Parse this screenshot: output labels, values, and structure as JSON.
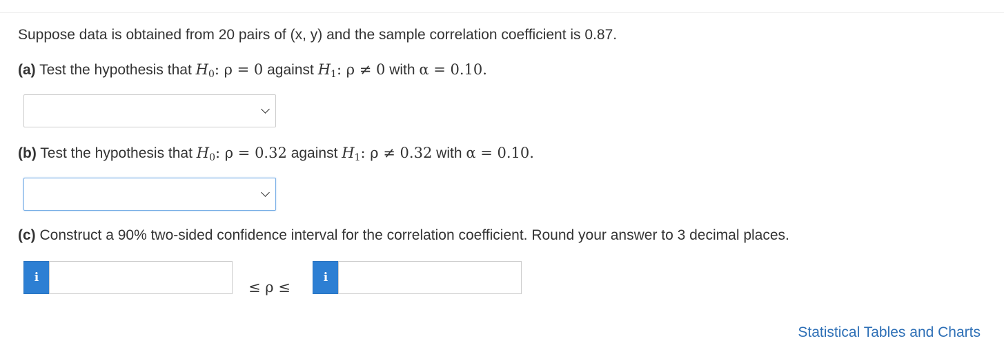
{
  "problem": {
    "intro": "Suppose data is obtained from 20 pairs of (x, y) and the sample correlation coefficient is 0.87.",
    "part_a": {
      "label": "(a)",
      "text_before": "Test the hypothesis that",
      "h0_symbol": "H",
      "h0_sub": "0",
      "h0_expr": ": ρ = 0",
      "against": "against",
      "h1_symbol": "H",
      "h1_sub": "1",
      "h1_expr": ": ρ ≠ 0",
      "with": "with",
      "alpha_expr": "α = 0.10.",
      "select_value": ""
    },
    "part_b": {
      "label": "(b)",
      "text_before": "Test the hypothesis that",
      "h0_symbol": "H",
      "h0_sub": "0",
      "h0_expr": ": ρ = 0.32",
      "against": "against",
      "h1_symbol": "H",
      "h1_sub": "1",
      "h1_expr": ": ρ ≠ 0.32",
      "with": "with",
      "alpha_expr": "α = 0.10.",
      "select_value": ""
    },
    "part_c": {
      "label": "(c)",
      "text": "Construct a 90% two-sided confidence interval for the correlation coefficient. Round your answer to 3 decimal places.",
      "info_glyph": "i",
      "lower_value": "",
      "upper_value": "",
      "between_expr": "≤ ρ ≤"
    }
  },
  "footer": {
    "link_text": "Statistical Tables and Charts"
  },
  "colors": {
    "link": "#2d6fb6",
    "info_button": "#2d7fd3",
    "focus_border": "#77aee6"
  },
  "icons": {
    "dropdown": "chevron-down-icon",
    "info": "info-icon"
  }
}
